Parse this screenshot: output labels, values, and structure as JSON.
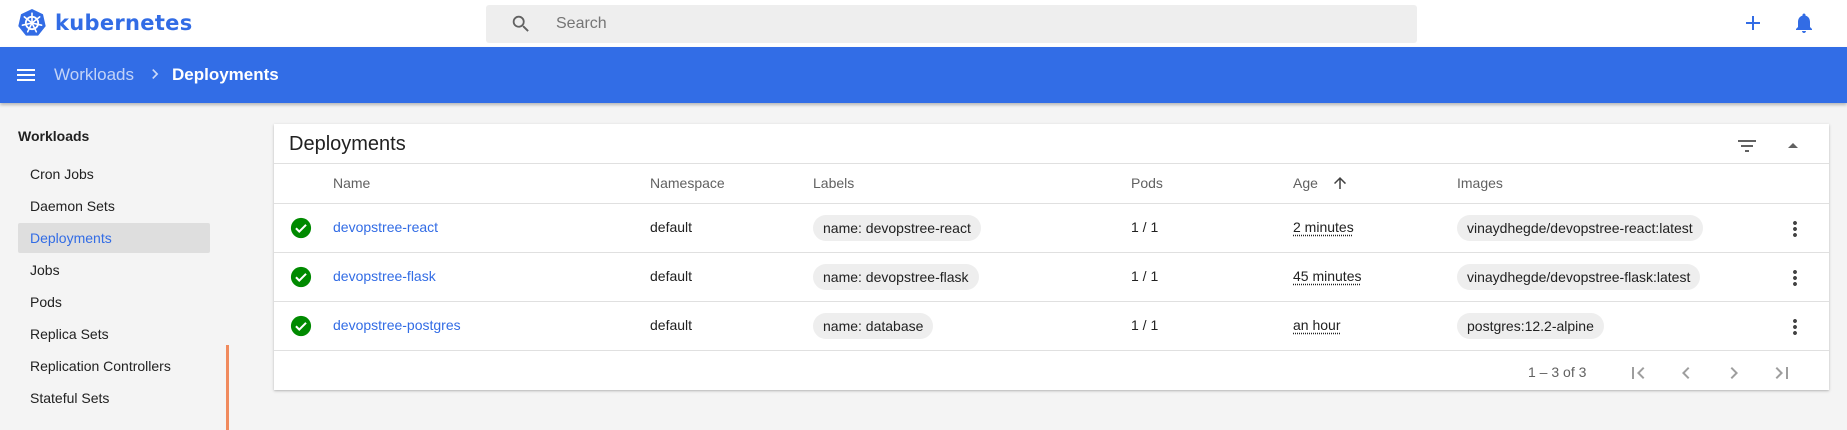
{
  "app": {
    "name": "kubernetes",
    "brand_color": "#326ce5",
    "logo_icon": "kubernetes-helm-icon"
  },
  "search": {
    "placeholder": "Search",
    "value": ""
  },
  "topbar": {
    "create_icon": "plus-icon",
    "notifications_icon": "bell-icon"
  },
  "breadcrumb": {
    "parent": "Workloads",
    "current": "Deployments"
  },
  "sidebar": {
    "section_title": "Workloads",
    "items": [
      {
        "label": "Cron Jobs",
        "active": false
      },
      {
        "label": "Daemon Sets",
        "active": false
      },
      {
        "label": "Deployments",
        "active": true
      },
      {
        "label": "Jobs",
        "active": false
      },
      {
        "label": "Pods",
        "active": false
      },
      {
        "label": "Replica Sets",
        "active": false
      },
      {
        "label": "Replication Controllers",
        "active": false
      },
      {
        "label": "Stateful Sets",
        "active": false
      }
    ]
  },
  "card": {
    "title": "Deployments",
    "columns": {
      "name": "Name",
      "namespace": "Namespace",
      "labels": "Labels",
      "pods": "Pods",
      "age": "Age",
      "images": "Images"
    },
    "sort": {
      "column": "Age",
      "direction": "ascending"
    },
    "rows": [
      {
        "status": "running",
        "name": "devopstree-react",
        "namespace": "default",
        "label": "name: devopstree-react",
        "pods": "1 / 1",
        "age": "2 minutes",
        "image": "vinaydhegde/devopstree-react:latest"
      },
      {
        "status": "running",
        "name": "devopstree-flask",
        "namespace": "default",
        "label": "name: devopstree-flask",
        "pods": "1 / 1",
        "age": "45 minutes",
        "image": "vinaydhegde/devopstree-flask:latest"
      },
      {
        "status": "running",
        "name": "devopstree-postgres",
        "namespace": "default",
        "label": "name: database",
        "pods": "1 / 1",
        "age": "an hour",
        "image": "postgres:12.2-alpine"
      }
    ],
    "pagination": {
      "range": "1 – 3 of 3"
    }
  },
  "colors": {
    "toolbar": "#326de6",
    "status_ok": "#008a00",
    "scroll_marker": "#f08a5d"
  }
}
